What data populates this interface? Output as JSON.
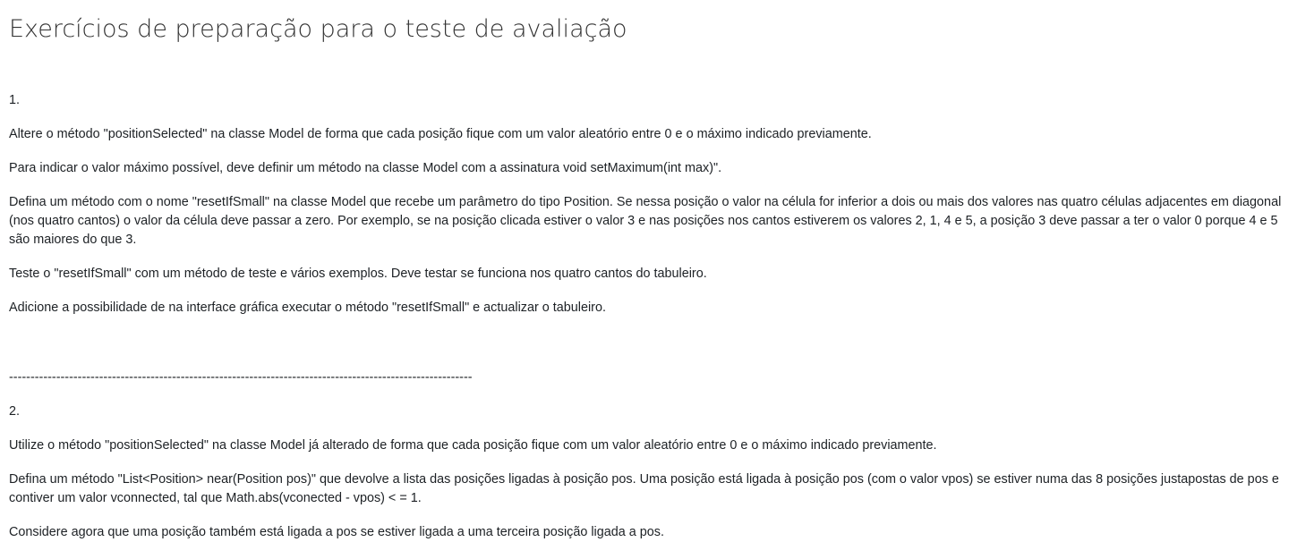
{
  "title": "Exercícios de preparação para o teste de avaliação",
  "section1": {
    "number": "1.",
    "paragraphs": [
      "Altere o método \"positionSelected\" na classe Model de forma que cada posição fique com um valor aleatório entre 0 e o máximo indicado previamente.",
      "Para indicar o valor máximo possível, deve definir um método na classe Model com a assinatura void setMaximum(int max)\".",
      "Defina um método com o nome \"resetIfSmall\" na classe Model que recebe um parâmetro do tipo Position. Se nessa posição o valor na célula for inferior a dois ou mais dos valores nas quatro células adjacentes em diagonal (nos quatro cantos) o valor da célula deve passar a zero. Por exemplo, se na posição clicada estiver o valor 3 e nas posições nos cantos estiverem os valores 2, 1, 4 e 5, a posição 3 deve passar a ter o valor 0 porque 4 e 5 são maiores do que 3.",
      "Teste o \"resetIfSmall\" com um método de teste e vários exemplos. Deve testar se funciona nos quatro cantos do tabuleiro.",
      "Adicione a possibilidade de na interface gráfica executar o método \"resetIfSmall\"  e actualizar o tabuleiro."
    ]
  },
  "divider": "------------------------------------------------------------------------------------------------------------",
  "section2": {
    "number": "2.",
    "paragraphs": [
      "Utilize o método \"positionSelected\" na classe Model já alterado de forma que cada posição fique com um valor aleatório entre 0 e o máximo indicado previamente.",
      "Defina um método \"List<Position> near(Position pos)\"  que devolve a lista das posições ligadas à posição pos. Uma posição está ligada à posição pos (com o valor vpos) se estiver numa das 8 posições justapostas de pos e contiver um valor vconnected, tal que Math.abs(vconected - vpos) < = 1.",
      "Considere agora que uma posição também está ligada a pos se estiver ligada a uma terceira posição ligada a pos."
    ]
  }
}
